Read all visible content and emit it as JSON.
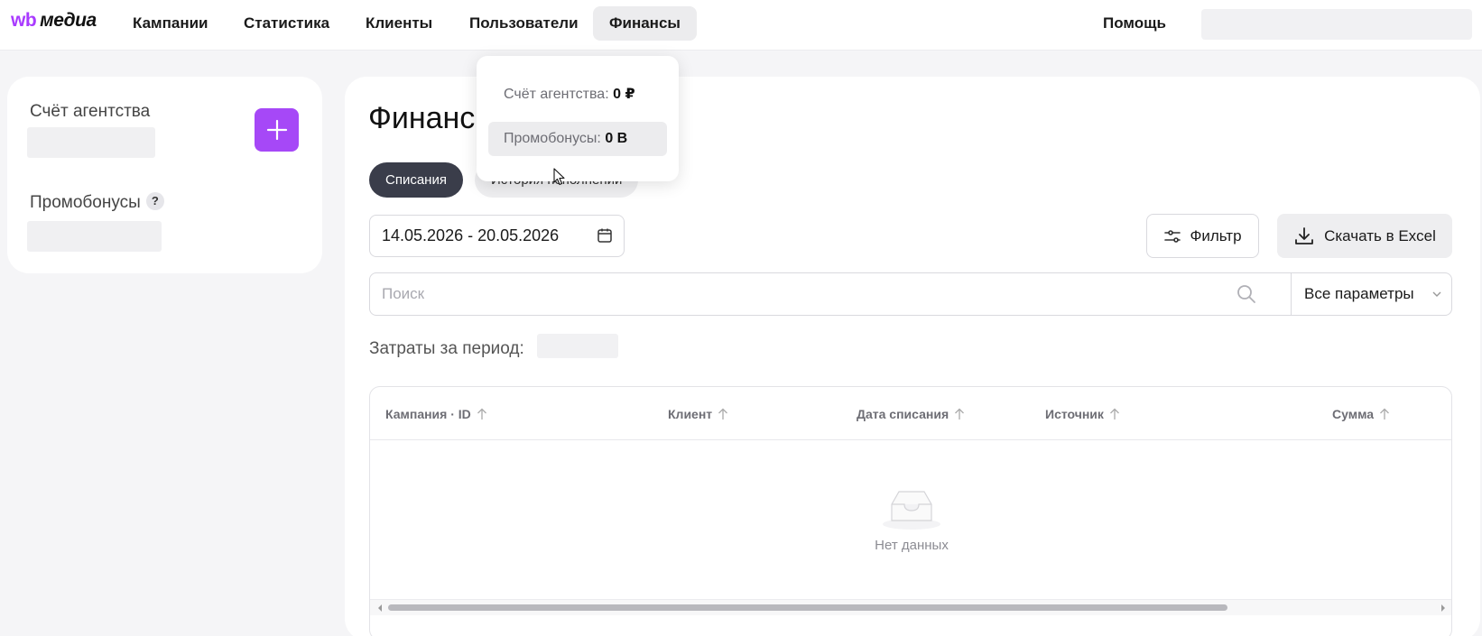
{
  "header": {
    "logo_mark": "wb",
    "logo_text": "медиа",
    "nav": [
      {
        "label": "Кампании"
      },
      {
        "label": "Статистика"
      },
      {
        "label": "Клиенты"
      },
      {
        "label": "Пользователи"
      },
      {
        "label": "Финансы",
        "active": true
      }
    ],
    "help_label": "Помощь"
  },
  "balance_dropdown": {
    "items": [
      {
        "label": "Счёт агентства:",
        "value": "0 ₽"
      },
      {
        "label": "Промобонусы:",
        "value": "0 В"
      }
    ]
  },
  "left_panel": {
    "agency_account_label": "Счёт агентства",
    "promobonuses_label": "Промобонусы",
    "help_badge": "?"
  },
  "main": {
    "title": "Финансы",
    "tabs": [
      {
        "label": "Списания",
        "active": true
      },
      {
        "label": "История пополнений",
        "active": false
      }
    ],
    "date_range": "14.05.2026 - 20.05.2026",
    "filter_label": "Фильтр",
    "excel_label": "Скачать в Excel",
    "search": {
      "placeholder": "Поиск",
      "value": ""
    },
    "params_select": "Все параметры",
    "period_label": "Затраты за период:",
    "table": {
      "columns": [
        "Кампания · ID",
        "Клиент",
        "Дата списания",
        "Источник",
        "Сумма"
      ],
      "empty_text": "Нет данных"
    }
  },
  "colors": {
    "accent": "#a648f7",
    "tab_active": "#3a3d4a",
    "background": "#f5f5f7"
  }
}
